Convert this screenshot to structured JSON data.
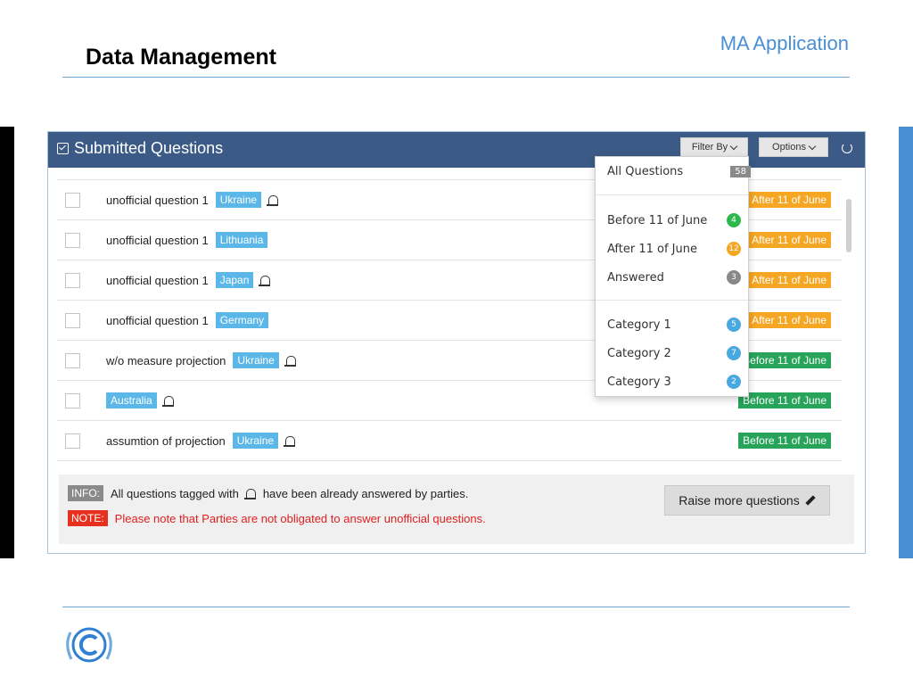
{
  "slide": {
    "title": "Data Management",
    "app_label": "MA Application"
  },
  "panel": {
    "title": "Submitted Questions",
    "filter_label": "Filter By",
    "options_label": "Options"
  },
  "rows": [
    {
      "text": "unofficial question 1",
      "country": "Ukraine",
      "bell": true,
      "status": "After 11 of June"
    },
    {
      "text": "unofficial question 1",
      "country": "Lithuania",
      "bell": false,
      "status": "After 11 of June"
    },
    {
      "text": "unofficial question 1",
      "country": "Japan",
      "bell": true,
      "status": "After 11 of June"
    },
    {
      "text": "unofficial question 1",
      "country": "Germany",
      "bell": false,
      "status": "After 11 of June"
    },
    {
      "text": "w/o measure projection",
      "country": "Ukraine",
      "bell": true,
      "status": "Before 11 of June"
    },
    {
      "text": "",
      "country": "Australia",
      "bell": true,
      "status": "Before 11 of June"
    },
    {
      "text": "assumtion of projection",
      "country": "Ukraine",
      "bell": true,
      "status": "Before 11 of June"
    }
  ],
  "footer": {
    "info_label": "INFO:",
    "info_text_pre": "All questions tagged with",
    "info_text_post": "have been already answered by parties.",
    "note_label": "NOTE:",
    "note_text": "Please note that Parties are not obligated to answer unofficial questions.",
    "raise_button": "Raise more questions"
  },
  "filter_menu": {
    "all": {
      "label": "All Questions",
      "count": "58"
    },
    "groups": [
      {
        "label": "Before 11 of June",
        "count": "4",
        "color": "#2db84d"
      },
      {
        "label": "After 11 of June",
        "count": "12",
        "color": "#f5a623"
      },
      {
        "label": "Answered",
        "count": "3",
        "color": "#888888"
      },
      {
        "label": "Category 1",
        "count": "5",
        "color": "#4aa8e0"
      },
      {
        "label": "Category 2",
        "count": "7",
        "color": "#4aa8e0"
      },
      {
        "label": "Category 3",
        "count": "2",
        "color": "#4aa8e0"
      }
    ]
  },
  "colors": {
    "header_bg": "#3b5b86",
    "after_status": "#f5a623",
    "before_status": "#27a35a",
    "country_tag": "#5bb7e8",
    "accent": "#4a8fd4"
  }
}
